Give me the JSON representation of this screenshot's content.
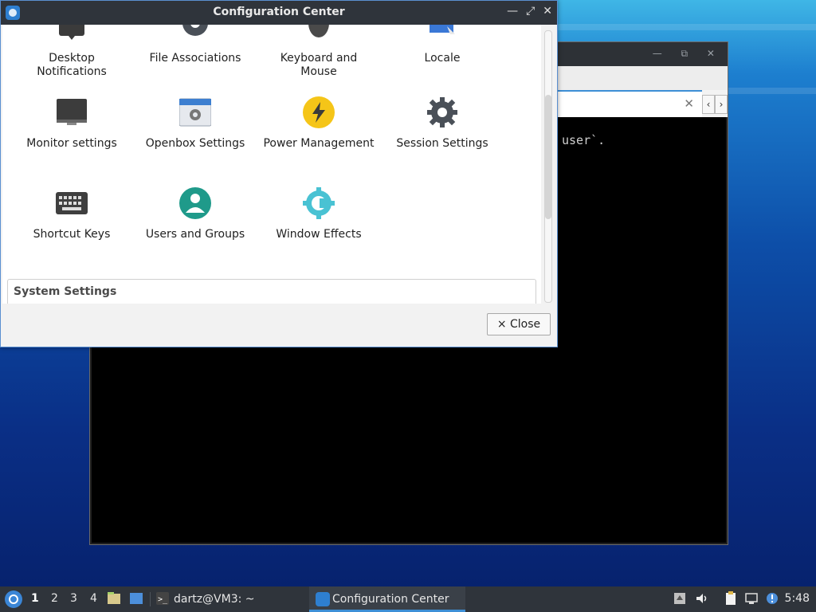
{
  "terminal": {
    "visible_text": "user`."
  },
  "config_center": {
    "title": "Configuration Center",
    "items": [
      {
        "label": "Desktop\nNotifications",
        "line1": "Desktop",
        "line2": "Notifications"
      },
      {
        "label": "File Associations"
      },
      {
        "label": "Keyboard and Mouse",
        "line1": "Keyboard and",
        "line2": "Mouse"
      },
      {
        "label": "Locale"
      },
      {
        "label": "Monitor settings"
      },
      {
        "label": "Openbox Settings"
      },
      {
        "label": "Power Management"
      },
      {
        "label": "Session Settings"
      },
      {
        "label": "Shortcut Keys"
      },
      {
        "label": "Users and Groups"
      },
      {
        "label": "Window Effects"
      }
    ],
    "section_title": "System Settings",
    "close_label": "Close",
    "close_icon": "×"
  },
  "taskbar": {
    "workspaces": [
      "1",
      "2",
      "3",
      "4"
    ],
    "active_workspace": "1",
    "terminal_task": "dartz@VM3: ~",
    "cc_task": "Configuration Center",
    "clock": "5:48"
  },
  "colors": {
    "accent": "#3d8fd6",
    "titlebar": "#2f343b"
  }
}
